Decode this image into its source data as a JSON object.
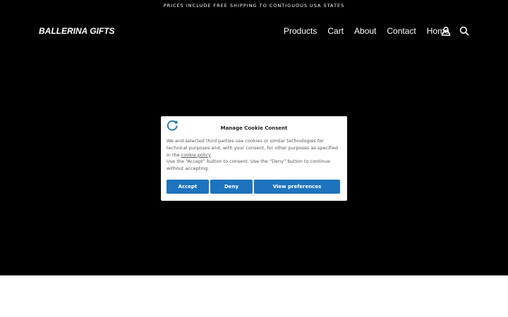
{
  "announcement": "PRICES INCLUDE FREE SHIPPING TO CONTIGUOUS USA STATES",
  "header": {
    "logo": "BALLERINA GIFTS",
    "nav": [
      "Products",
      "Cart",
      "About",
      "Contact",
      "Home"
    ],
    "icons": [
      "account-icon",
      "search-icon"
    ]
  },
  "cookie_modal": {
    "title": "Manage Cookie Consent",
    "body_text_1": "We and selected third parties use cookies or similar technologies for technical purposes and, with your consent, for other purposes as specified in the ",
    "body_link": "cookie policy",
    "body_text_2": "Use the “Accept” button to consent. Use the “Deny” button to continue without accepting.",
    "buttons": {
      "accept": "Accept",
      "deny": "Deny",
      "preferences": "View preferences"
    }
  },
  "colors": {
    "hero_background": "#000000",
    "button_blue": "#1e73be",
    "logo_blue": "#1e73be"
  }
}
